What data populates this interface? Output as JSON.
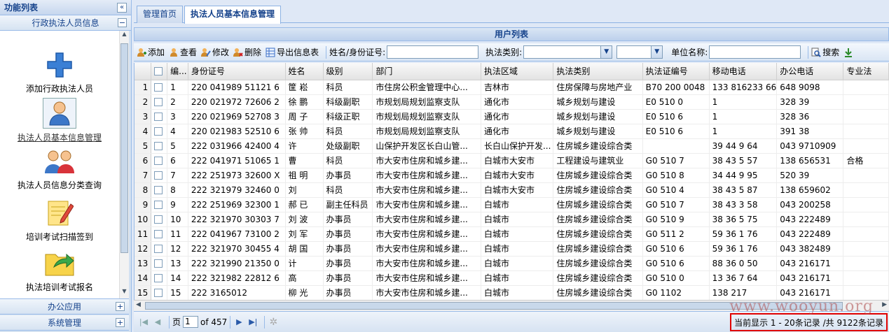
{
  "sidebar": {
    "title": "功能列表",
    "collapse_icon": "«",
    "section_active": "行政执法人员信息",
    "section_active_toggle": "−",
    "items": [
      {
        "label": "添加行政执法人员",
        "icon": "plus-icon"
      },
      {
        "label": "执法人员基本信息管理",
        "icon": "person-icon"
      },
      {
        "label": "执法人员信息分类查询",
        "icon": "users-icon"
      },
      {
        "label": "培训考试扫描签到",
        "icon": "pencil-note-icon"
      },
      {
        "label": "执法培训考试报名",
        "icon": "folder-arrow-icon"
      }
    ],
    "sections": [
      {
        "label": "办公应用",
        "toggle": "+"
      },
      {
        "label": "系统管理",
        "toggle": "+"
      }
    ]
  },
  "tabs": [
    {
      "label": "管理首页",
      "active": false
    },
    {
      "label": "执法人员基本信息管理",
      "active": true
    }
  ],
  "panel_title": "用户列表",
  "toolbar": {
    "add": "添加",
    "view": "查看",
    "edit": "修改",
    "delete": "删除",
    "export": "导出信息表",
    "name_id_label": "姓名/身份证号:",
    "type_label": "执法类别:",
    "unit_label": "单位名称:",
    "search": "搜索"
  },
  "grid": {
    "columns": [
      "编...",
      "身份证号",
      "姓名",
      "级别",
      "部门",
      "执法区域",
      "执法类别",
      "执法证编号",
      "移动电话",
      "办公电话",
      "专业法"
    ],
    "rows": [
      [
        "1",
        "220 041989 51121 6",
        "筐 崧",
        "科员",
        "市住房公积金管理中心...",
        "吉林市",
        "住房保障与房地产业",
        "B70 200 0048",
        "133 816233 66",
        "648 9098",
        ""
      ],
      [
        "2",
        "220 021972 72606 2",
        "徐 鹏",
        "科级副职",
        "市规划局规划监察支队",
        "通化市",
        "城乡规划与建设",
        "E0 510 0",
        "1",
        "328 39",
        ""
      ],
      [
        "3",
        "220 021969 52708 3",
        "周 子",
        "科级正职",
        "市规划局规划监察支队",
        "通化市",
        "城乡规划与建设",
        "E0 510 6",
        "1",
        "328 36",
        ""
      ],
      [
        "4",
        "220 021983 52510 6",
        "张 帅",
        "科员",
        "市规划局规划监察支队",
        "通化市",
        "城乡规划与建设",
        "E0 510 6",
        "1",
        "391 38",
        ""
      ],
      [
        "5",
        "222 031966 42400 4",
        "许",
        "处级副职",
        "山保护开发区长白山管...",
        "长白山保护开发...",
        "住房城乡建设综合类",
        "",
        "39 44 9 64",
        "043 9710909",
        ""
      ],
      [
        "6",
        "222 041971 51065 1",
        "曹",
        "科员",
        "市大安市住房和城乡建...",
        "白城市大安市",
        "工程建设与建筑业",
        "G0 510 7",
        "38 43 5 57",
        "138 656531",
        "合格"
      ],
      [
        "7",
        "222 251973 32600 X",
        "祖 明",
        "办事员",
        "市大安市住房和城乡建...",
        "白城市大安市",
        "住房城乡建设综合类",
        "G0 510 8",
        "34 44 9 95",
        "520 39",
        ""
      ],
      [
        "8",
        "222 321979 32460 0",
        "刘",
        "科员",
        "市大安市住房和城乡建...",
        "白城市大安市",
        "住房城乡建设综合类",
        "G0 510 4",
        "38 43 5 87",
        "138 659602",
        ""
      ],
      [
        "9",
        "222 251969 32300 1",
        "郝 已",
        "副主任科员",
        "市大安市住房和城乡建...",
        "白城市",
        "住房城乡建设综合类",
        "G0 510 7",
        "38 43 3 58",
        "043 200258",
        ""
      ],
      [
        "10",
        "222 321970 30303 7",
        "刘 波",
        "办事员",
        "市大安市住房和城乡建...",
        "白城市",
        "住房城乡建设综合类",
        "G0 510 9",
        "38 36 5 75",
        "043 222489",
        ""
      ],
      [
        "11",
        "222 041967 73100 2",
        "刘 军",
        "办事员",
        "市大安市住房和城乡建...",
        "白城市",
        "住房城乡建设综合类",
        "G0 511 2",
        "59 36 1 76",
        "043 222489",
        ""
      ],
      [
        "12",
        "222 321970 30455 4",
        "胡 国",
        "办事员",
        "市大安市住房和城乡建...",
        "白城市",
        "住房城乡建设综合类",
        "G0 510 6",
        "59 36 1 76",
        "043 382489",
        ""
      ],
      [
        "13",
        "222 321990 21350 0",
        "计",
        "办事员",
        "市大安市住房和城乡建...",
        "白城市",
        "住房城乡建设综合类",
        "G0 510 6",
        "88 36 0 50",
        "043 216171",
        ""
      ],
      [
        "14",
        "222 321982 22812 6",
        "高",
        "办事员",
        "市大安市住房和城乡建...",
        "白城市",
        "住房城乡建设综合类",
        "G0 510 0",
        "13 36 7 64",
        "043 216171",
        ""
      ],
      [
        "15",
        "222 3165012",
        "柳 光",
        "办事员",
        "市大安市住房和城乡建...",
        "白城市",
        "住房城乡建设综合类",
        "G0 1102",
        "138 217",
        "043 216171",
        ""
      ]
    ]
  },
  "pager": {
    "page_label": "页",
    "page_value": "1",
    "of_total": "of 457",
    "info": "当前显示 1 - 20条记录 /共 9122条记录"
  },
  "watermark": "www.wooyun.org",
  "colors": {
    "accent": "#15428b",
    "border": "#99bbe8",
    "highlight": "#e00000"
  }
}
